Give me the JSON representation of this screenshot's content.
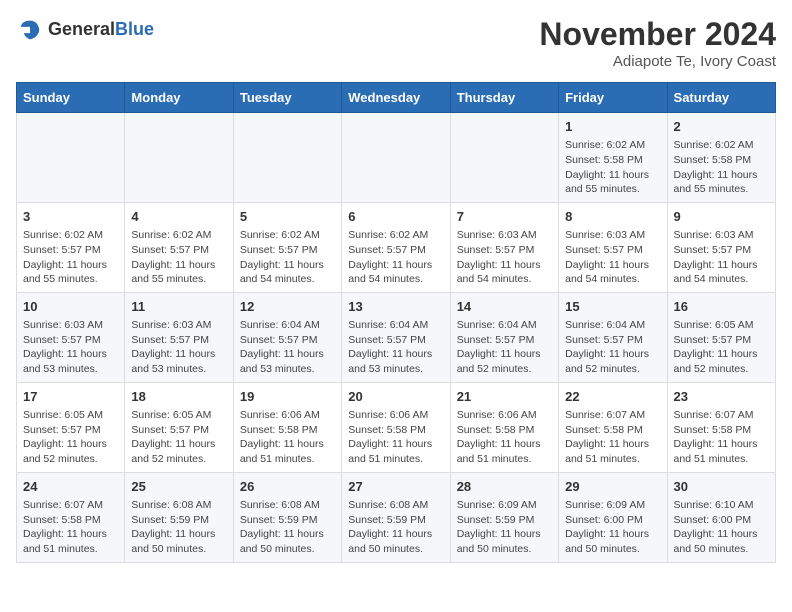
{
  "header": {
    "logo_line1": "General",
    "logo_line2": "Blue",
    "month_title": "November 2024",
    "location": "Adiapote Te, Ivory Coast"
  },
  "days_of_week": [
    "Sunday",
    "Monday",
    "Tuesday",
    "Wednesday",
    "Thursday",
    "Friday",
    "Saturday"
  ],
  "weeks": [
    [
      {
        "day": "",
        "info": ""
      },
      {
        "day": "",
        "info": ""
      },
      {
        "day": "",
        "info": ""
      },
      {
        "day": "",
        "info": ""
      },
      {
        "day": "",
        "info": ""
      },
      {
        "day": "1",
        "info": "Sunrise: 6:02 AM\nSunset: 5:58 PM\nDaylight: 11 hours and 55 minutes."
      },
      {
        "day": "2",
        "info": "Sunrise: 6:02 AM\nSunset: 5:58 PM\nDaylight: 11 hours and 55 minutes."
      }
    ],
    [
      {
        "day": "3",
        "info": "Sunrise: 6:02 AM\nSunset: 5:57 PM\nDaylight: 11 hours and 55 minutes."
      },
      {
        "day": "4",
        "info": "Sunrise: 6:02 AM\nSunset: 5:57 PM\nDaylight: 11 hours and 55 minutes."
      },
      {
        "day": "5",
        "info": "Sunrise: 6:02 AM\nSunset: 5:57 PM\nDaylight: 11 hours and 54 minutes."
      },
      {
        "day": "6",
        "info": "Sunrise: 6:02 AM\nSunset: 5:57 PM\nDaylight: 11 hours and 54 minutes."
      },
      {
        "day": "7",
        "info": "Sunrise: 6:03 AM\nSunset: 5:57 PM\nDaylight: 11 hours and 54 minutes."
      },
      {
        "day": "8",
        "info": "Sunrise: 6:03 AM\nSunset: 5:57 PM\nDaylight: 11 hours and 54 minutes."
      },
      {
        "day": "9",
        "info": "Sunrise: 6:03 AM\nSunset: 5:57 PM\nDaylight: 11 hours and 54 minutes."
      }
    ],
    [
      {
        "day": "10",
        "info": "Sunrise: 6:03 AM\nSunset: 5:57 PM\nDaylight: 11 hours and 53 minutes."
      },
      {
        "day": "11",
        "info": "Sunrise: 6:03 AM\nSunset: 5:57 PM\nDaylight: 11 hours and 53 minutes."
      },
      {
        "day": "12",
        "info": "Sunrise: 6:04 AM\nSunset: 5:57 PM\nDaylight: 11 hours and 53 minutes."
      },
      {
        "day": "13",
        "info": "Sunrise: 6:04 AM\nSunset: 5:57 PM\nDaylight: 11 hours and 53 minutes."
      },
      {
        "day": "14",
        "info": "Sunrise: 6:04 AM\nSunset: 5:57 PM\nDaylight: 11 hours and 52 minutes."
      },
      {
        "day": "15",
        "info": "Sunrise: 6:04 AM\nSunset: 5:57 PM\nDaylight: 11 hours and 52 minutes."
      },
      {
        "day": "16",
        "info": "Sunrise: 6:05 AM\nSunset: 5:57 PM\nDaylight: 11 hours and 52 minutes."
      }
    ],
    [
      {
        "day": "17",
        "info": "Sunrise: 6:05 AM\nSunset: 5:57 PM\nDaylight: 11 hours and 52 minutes."
      },
      {
        "day": "18",
        "info": "Sunrise: 6:05 AM\nSunset: 5:57 PM\nDaylight: 11 hours and 52 minutes."
      },
      {
        "day": "19",
        "info": "Sunrise: 6:06 AM\nSunset: 5:58 PM\nDaylight: 11 hours and 51 minutes."
      },
      {
        "day": "20",
        "info": "Sunrise: 6:06 AM\nSunset: 5:58 PM\nDaylight: 11 hours and 51 minutes."
      },
      {
        "day": "21",
        "info": "Sunrise: 6:06 AM\nSunset: 5:58 PM\nDaylight: 11 hours and 51 minutes."
      },
      {
        "day": "22",
        "info": "Sunrise: 6:07 AM\nSunset: 5:58 PM\nDaylight: 11 hours and 51 minutes."
      },
      {
        "day": "23",
        "info": "Sunrise: 6:07 AM\nSunset: 5:58 PM\nDaylight: 11 hours and 51 minutes."
      }
    ],
    [
      {
        "day": "24",
        "info": "Sunrise: 6:07 AM\nSunset: 5:58 PM\nDaylight: 11 hours and 51 minutes."
      },
      {
        "day": "25",
        "info": "Sunrise: 6:08 AM\nSunset: 5:59 PM\nDaylight: 11 hours and 50 minutes."
      },
      {
        "day": "26",
        "info": "Sunrise: 6:08 AM\nSunset: 5:59 PM\nDaylight: 11 hours and 50 minutes."
      },
      {
        "day": "27",
        "info": "Sunrise: 6:08 AM\nSunset: 5:59 PM\nDaylight: 11 hours and 50 minutes."
      },
      {
        "day": "28",
        "info": "Sunrise: 6:09 AM\nSunset: 5:59 PM\nDaylight: 11 hours and 50 minutes."
      },
      {
        "day": "29",
        "info": "Sunrise: 6:09 AM\nSunset: 6:00 PM\nDaylight: 11 hours and 50 minutes."
      },
      {
        "day": "30",
        "info": "Sunrise: 6:10 AM\nSunset: 6:00 PM\nDaylight: 11 hours and 50 minutes."
      }
    ]
  ]
}
